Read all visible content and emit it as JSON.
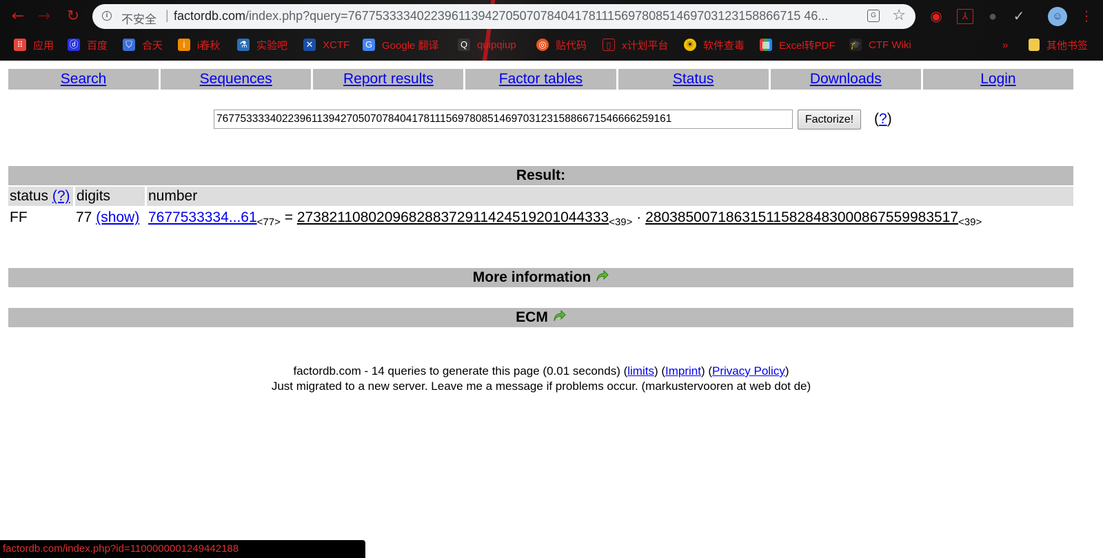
{
  "browser": {
    "insecure_label": "不安全",
    "url_host": "factordb.com",
    "url_rest": "/index.php?query=767753333402239611394270507078404178111569780851469703123158866715 46...",
    "bookmarks": [
      {
        "label": "应用",
        "icon": "apps-grid-icon",
        "color": "#e8453c"
      },
      {
        "label": "百度",
        "icon": "baidu-paw-icon",
        "color": "#2932e1"
      },
      {
        "label": "合天",
        "icon": "hetian-shield-icon",
        "color": "#3a6fd8"
      },
      {
        "label": "i春秋",
        "icon": "ichunqiu-icon",
        "color": "#f08a00"
      },
      {
        "label": "实验吧",
        "icon": "shiyanba-icon",
        "color": "#2a6fb8"
      },
      {
        "label": "XCTF",
        "icon": "xctf-icon",
        "color": "#1a4fa8"
      },
      {
        "label": "Google 翻译",
        "icon": "google-translate-icon",
        "color": "#4285f4"
      },
      {
        "label": "quipqiup",
        "icon": "quipqiup-icon",
        "color": "#333333"
      },
      {
        "label": "贴代码",
        "icon": "ubuntu-icon",
        "color": "#e95420"
      },
      {
        "label": "x计划平台",
        "icon": "document-icon",
        "color": "#d02020"
      },
      {
        "label": "软件查毒",
        "icon": "bulb-icon",
        "color": "#f2c200"
      },
      {
        "label": "Excel转PDF",
        "icon": "excel-pdf-icon",
        "color": "#7b3fa0"
      },
      {
        "label": "CTF Wiki",
        "icon": "ctfwiki-icon",
        "color": "#222222"
      }
    ],
    "more_bookmarks": "»",
    "other_bookmarks": "其他书签",
    "status_url": "factordb.com/index.php?id=1100000001249442188"
  },
  "menu": [
    "Search",
    "Sequences",
    "Report results",
    "Factor tables",
    "Status",
    "Downloads",
    "Login"
  ],
  "query": {
    "value": "76775333340223961139427050707840417811156978085146970312315886671546666259161",
    "button_label": "Factorize!",
    "help_open": "(",
    "help_link": "?",
    "help_close": ")"
  },
  "result": {
    "title": "Result:",
    "headers": {
      "status": "status",
      "status_help": "(?)",
      "digits": "digits",
      "number": "number"
    },
    "row": {
      "status": "FF",
      "digits": "77",
      "show_link": "(show)",
      "number": "7677533334...61",
      "number_sub": "<77>",
      "equals": "=",
      "factor1": "273821108020968288372911424519201044333",
      "factor1_sub": "<39>",
      "dot": "·",
      "factor2": "280385007186315115828483000867559983517",
      "factor2_sub": "<39>"
    }
  },
  "more_info": "More information",
  "ecm": "ECM",
  "footer": {
    "line1_prefix": "factordb.com - 14 queries to generate this page (0.01 seconds) (",
    "limits": "limits",
    "mid1": ") (",
    "imprint": "Imprint",
    "mid2": ") (",
    "privacy": "Privacy Policy",
    "suffix": ")",
    "line2": "Just migrated to a new server. Leave me a message if problems occur. (markustervooren at web dot de)"
  },
  "colors": {
    "menu_bg": "#bbbbbb",
    "header_row_bg": "#dddddd",
    "link": "#0000ee",
    "arrow_green": "#5cb82e"
  }
}
